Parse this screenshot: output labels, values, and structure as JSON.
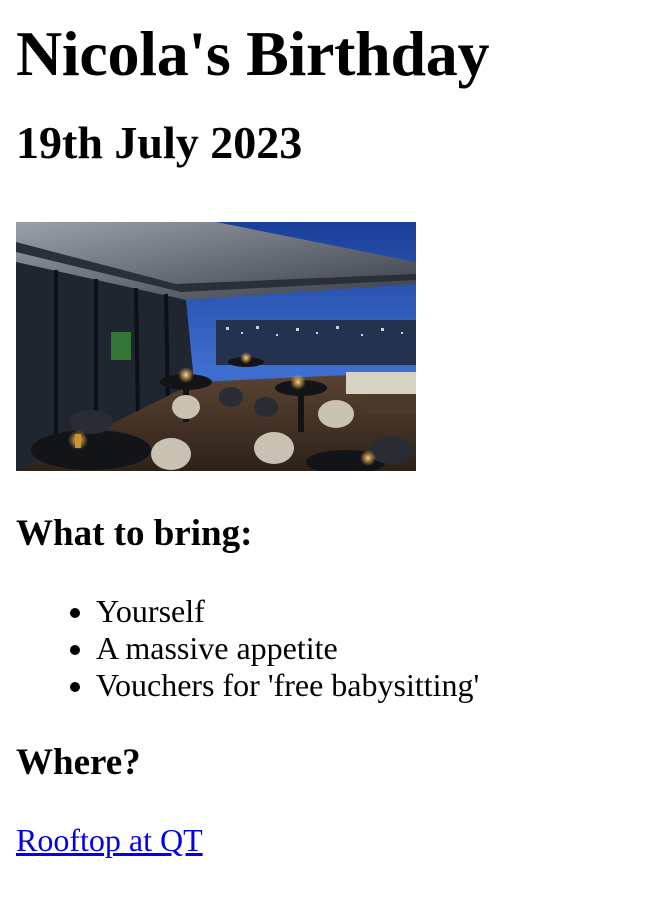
{
  "page": {
    "title": "Nicola's Birthday",
    "date": "19th July 2023",
    "bring_heading": "What to bring:",
    "bring_items": [
      "Yourself",
      "A massive appetite",
      "Vouchers for 'free babysitting'"
    ],
    "where_heading": "Where?",
    "venue_link": "Rooftop at QT"
  },
  "colors": {
    "link": "#0000ee",
    "text": "#000000",
    "background": "#ffffff"
  }
}
